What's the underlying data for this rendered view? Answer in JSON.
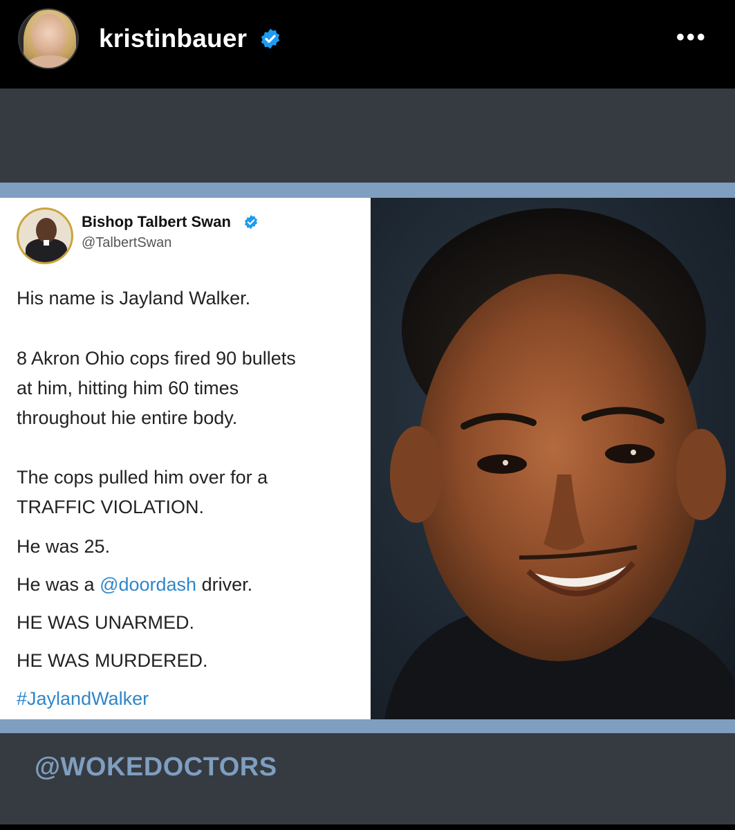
{
  "header": {
    "username": "kristinbauer",
    "more_label": "•••"
  },
  "tweet": {
    "author_name": "Bishop Talbert Swan",
    "author_handle": "@TalbertSwan",
    "lines": [
      "His name is Jayland Walker.",
      "8 Akron Ohio cops fired 90 bullets",
      "at him, hitting him 60 times",
      "throughout hie entire body.",
      "The cops pulled him over for a",
      "TRAFFIC VIOLATION.",
      "He was 25."
    ],
    "doordash_prefix": "He was a ",
    "doordash_link": "@doordash",
    "doordash_suffix": " driver.",
    "unarmed": "HE WAS UNARMED.",
    "murdered": "HE WAS MURDERED.",
    "hashtag": "#JaylandWalker"
  },
  "watermark": "@WOKEDOCTORS",
  "colors": {
    "verified_blue": "#1d9bf0",
    "link_blue": "#2f86c9",
    "band_blue": "#7f9ec0",
    "stage_gray": "#363b42"
  }
}
